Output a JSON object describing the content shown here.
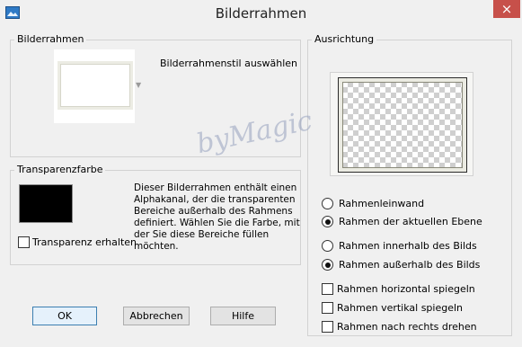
{
  "window": {
    "title": "Bilderrahmen",
    "close_icon": "×"
  },
  "frame_group": {
    "legend": "Bilderrahmen",
    "style_label": "Bilderrahmenstil auswählen"
  },
  "transparency_group": {
    "legend": "Transparenzfarbe",
    "swatch_color": "#000000",
    "description": "Dieser Bilderrahmen enthält einen Alphakanal, der die transparenten Bereiche außerhalb des Rahmens definiert. Wählen Sie die Farbe, mit der Sie diese Bereiche füllen möchten.",
    "keep_transparency": {
      "label": "Transparenz erhalten",
      "checked": false
    }
  },
  "orientation_group": {
    "legend": "Ausrichtung",
    "radio_group_1": [
      {
        "label": "Rahmenleinwand",
        "checked": false
      },
      {
        "label": "Rahmen der aktuellen Ebene",
        "checked": true
      }
    ],
    "radio_group_2": [
      {
        "label": "Rahmen innerhalb des Bilds",
        "checked": false
      },
      {
        "label": "Rahmen außerhalb des Bilds",
        "checked": true
      }
    ],
    "checkboxes": [
      {
        "label": "Rahmen horizontal spiegeln",
        "checked": false
      },
      {
        "label": "Rahmen vertikal spiegeln",
        "checked": false
      },
      {
        "label": "Rahmen nach rechts drehen",
        "checked": false
      }
    ]
  },
  "buttons": {
    "ok": "OK",
    "cancel": "Abbrechen",
    "help": "Hilfe"
  },
  "watermark": "byMagic"
}
